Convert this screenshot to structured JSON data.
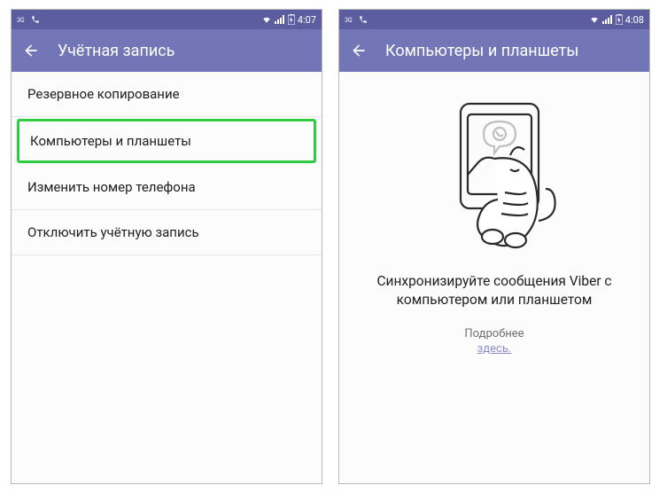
{
  "colors": {
    "status_bar": "#5b5da0",
    "app_bar": "#7376b6",
    "highlight": "#2ecc40",
    "link": "#8b8dc9"
  },
  "left": {
    "status": {
      "time": "4:07",
      "icons": {
        "network": "3G",
        "battery": "charging"
      }
    },
    "title": "Учётная запись",
    "menu": [
      {
        "label": "Резервное копирование"
      },
      {
        "label": "Компьютеры и планшеты",
        "highlighted": true
      },
      {
        "label": "Изменить номер телефона"
      },
      {
        "label": "Отключить учётную запись"
      }
    ]
  },
  "right": {
    "status": {
      "time": "4:08",
      "icons": {
        "network": "3G",
        "battery": "charging"
      }
    },
    "title": "Компьютеры и планшеты",
    "sync_message": "Синхронизируйте сообщения Viber с компьютером или планшетом",
    "more_label": "Подробнее",
    "here_link": "здесь."
  }
}
